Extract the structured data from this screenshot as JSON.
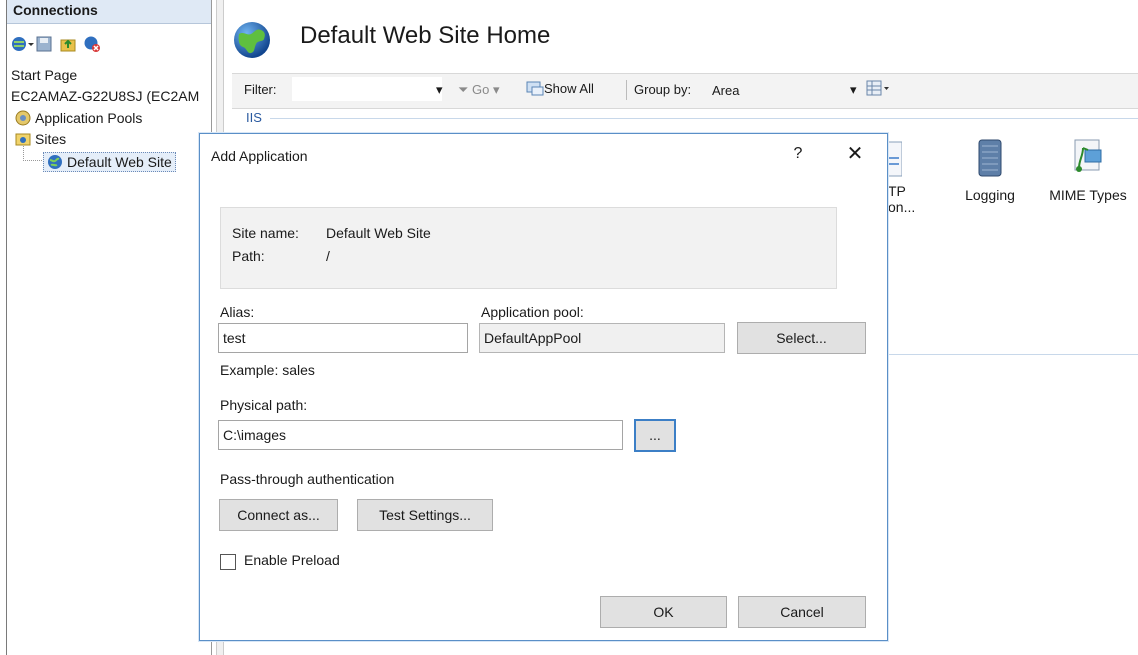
{
  "connections": {
    "header": "Connections",
    "tree": {
      "start_page": "Start Page",
      "server": "EC2AMAZ-G22U8SJ (EC2AM",
      "app_pools": "Application Pools",
      "sites": "Sites",
      "default_site": "Default Web Site"
    }
  },
  "main": {
    "title": "Default Web Site Home",
    "filter_bar": {
      "filter_label": "Filter:",
      "go_label": "Go",
      "show_all_label": "Show All",
      "group_by_label": "Group by:",
      "group_by_value": "Area"
    },
    "section_label": "IIS",
    "features": [
      {
        "label": "TP",
        "label2": "on..."
      },
      {
        "label": "Logging"
      },
      {
        "label": "MIME Types"
      }
    ]
  },
  "dialog": {
    "title": "Add Application",
    "help": "?",
    "close": "✕",
    "site_name_label": "Site name:",
    "site_name_value": "Default Web Site",
    "path_label": "Path:",
    "path_value": "/",
    "alias_label": "Alias:",
    "alias_value": "test",
    "app_pool_label": "Application pool:",
    "app_pool_value": "DefaultAppPool",
    "select_button": "Select...",
    "example_text": "Example: sales",
    "physical_path_label": "Physical path:",
    "physical_path_value": "C:\\images",
    "browse_button": "...",
    "pass_through_label": "Pass-through authentication",
    "connect_as_button": "Connect as...",
    "test_settings_button": "Test Settings...",
    "enable_preload_label": "Enable Preload",
    "enable_preload_checked": false,
    "ok_button": "OK",
    "cancel_button": "Cancel"
  }
}
